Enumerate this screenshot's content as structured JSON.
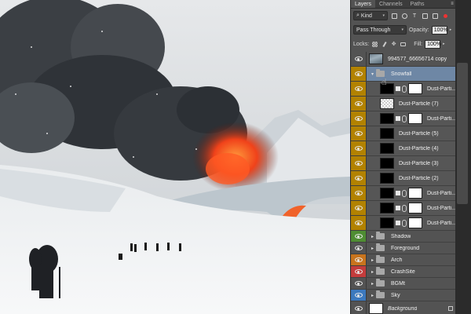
{
  "tabs": [
    {
      "label": "Layers",
      "active": true
    },
    {
      "label": "Channels",
      "active": false
    },
    {
      "label": "Paths",
      "active": false
    }
  ],
  "filter": {
    "kind_label": "Kind",
    "icons": [
      "image-filter-icon",
      "adjustment-filter-icon",
      "type-filter-icon",
      "shape-filter-icon",
      "smart-object-filter-icon",
      "filter-toggle-icon"
    ]
  },
  "blend": {
    "mode": "Pass Through",
    "opacity_label": "Opacity:",
    "opacity_value": "100%"
  },
  "locks": {
    "label": "Locks:",
    "fill_label": "Fill:",
    "fill_value": "100%"
  },
  "layers": [
    {
      "name": "994577_66656714 copy",
      "type": "layer",
      "thumb": "photo",
      "color": "none"
    },
    {
      "name": "Snowfall",
      "type": "group",
      "open": true,
      "selected": true,
      "color": "yellow"
    },
    {
      "name": "Dust-Parti...",
      "type": "child",
      "thumb": "black",
      "mask": "white"
    },
    {
      "name": "Dust-Particle (7)",
      "type": "child",
      "thumb": "checker"
    },
    {
      "name": "Dust-Parti...",
      "type": "child",
      "thumb": "black",
      "mask": "white"
    },
    {
      "name": "Dust-Particle (5)",
      "type": "child",
      "thumb": "black"
    },
    {
      "name": "Dust-Particle (4)",
      "type": "child",
      "thumb": "black"
    },
    {
      "name": "Dust-Particle (3)",
      "type": "child",
      "thumb": "black"
    },
    {
      "name": "Dust-Particle (2)",
      "type": "child",
      "thumb": "black"
    },
    {
      "name": "Dust-Parti...",
      "type": "child",
      "thumb": "black",
      "mask": "white"
    },
    {
      "name": "Dust-Parti...",
      "type": "child",
      "thumb": "black",
      "mask": "white"
    },
    {
      "name": "Dust-Parti...",
      "type": "child",
      "thumb": "black",
      "mask": "white"
    },
    {
      "name": "Shadow",
      "type": "group",
      "color": "green"
    },
    {
      "name": "Foreground",
      "type": "group",
      "color": "none"
    },
    {
      "name": "Arch",
      "type": "group",
      "color": "orange"
    },
    {
      "name": "CrashSite",
      "type": "group",
      "color": "red"
    },
    {
      "name": "BGMt",
      "type": "group",
      "color": "none"
    },
    {
      "name": "Sky",
      "type": "group",
      "color": "blue"
    },
    {
      "name": "Background",
      "type": "background",
      "thumb": "white",
      "locked": true
    }
  ],
  "label_colors": {
    "yellow": "#b28200",
    "green": "#4f8d33",
    "orange": "#c8741d",
    "red": "#c33c3c",
    "blue": "#3c79be",
    "none": "#535353",
    "selected": "#6e87a5"
  }
}
